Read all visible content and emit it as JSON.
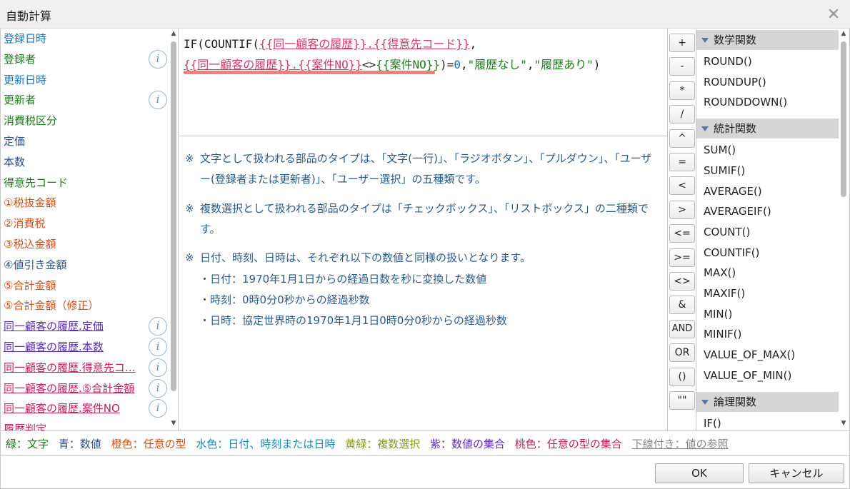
{
  "window": {
    "title": "自動計算"
  },
  "fields": [
    {
      "label": "登録日時",
      "color": "blue",
      "info": false
    },
    {
      "label": "登録者",
      "color": "green",
      "info": true
    },
    {
      "label": "更新日時",
      "color": "blue",
      "info": false
    },
    {
      "label": "更新者",
      "color": "green",
      "info": true
    },
    {
      "label": "消費税区分",
      "color": "green",
      "info": false
    },
    {
      "label": "定価",
      "color": "navy",
      "info": false
    },
    {
      "label": "本数",
      "color": "navy",
      "info": false
    },
    {
      "label": "得意先コード",
      "color": "green",
      "info": false
    },
    {
      "label": "①税抜金額",
      "color": "orange",
      "info": false
    },
    {
      "label": "②消費税",
      "color": "orange",
      "info": false
    },
    {
      "label": "③税込金額",
      "color": "orange",
      "info": false
    },
    {
      "label": "④値引き金額",
      "color": "navy",
      "info": false
    },
    {
      "label": "⑤合計金額",
      "color": "orange",
      "info": false
    },
    {
      "label": "⑤合計金額（修正）",
      "color": "orange",
      "info": false
    },
    {
      "label": "同一顧客の履歴.定価",
      "color": "purple",
      "info": true
    },
    {
      "label": "同一顧客の履歴.本数",
      "color": "purple",
      "info": true
    },
    {
      "label": "同一顧客の履歴.得意先コ…",
      "color": "pink",
      "info": true
    },
    {
      "label": "同一顧客の履歴.⑤合計金額",
      "color": "pink",
      "info": true
    },
    {
      "label": "同一顧客の履歴.案件NO",
      "color": "pink",
      "info": true
    },
    {
      "label": "履歴判定",
      "color": "pink",
      "info": false
    }
  ],
  "editor": {
    "line1": [
      {
        "t": "IF(COUNTIF(",
        "c": "dark"
      },
      {
        "t": "{{同一顧客の履歴}}.{{得意先コード}}",
        "c": "pink"
      },
      {
        "t": ",",
        "c": "dark"
      }
    ],
    "line2": [
      {
        "t": "{{同一顧客の履歴}}.{{案件NO}}",
        "c": "pink"
      },
      {
        "t": "<>",
        "c": "dark"
      },
      {
        "t": "{{案件NO}}",
        "c": "green"
      },
      {
        "t": ")=",
        "c": "dark"
      },
      {
        "t": "0",
        "c": "blue"
      },
      {
        "t": ",",
        "c": "dark"
      },
      {
        "t": "\"履歴なし\"",
        "c": "green"
      },
      {
        "t": ",",
        "c": "dark"
      },
      {
        "t": "\"履歴あり\"",
        "c": "green"
      },
      {
        "t": ")",
        "c": "dark"
      }
    ]
  },
  "notes": {
    "mark": "※",
    "n1": "文字として扱われる部品のタイプは、「文字(一行)」、「ラジオボタン」、「プルダウン」、「ユーザー(登録者または更新者)」、「ユーザー選択」の五種類です。",
    "n2": "複数選択として扱われる部品のタイプは「チェックボックス」、「リストボックス」の二種類です。",
    "n3": "日付、時刻、日時は、それぞれ以下の数値と同様の扱いとなります。",
    "s1": "・日付：1970年1月1日からの経過日数を秒に変換した数値",
    "s2": "・時刻：0時0分0秒からの経過秒数",
    "s3": "・日時：協定世界時の1970年1月1日0時0分0秒からの経過秒数"
  },
  "operators": [
    "+",
    "-",
    "*",
    "/",
    "^",
    "=",
    "<",
    ">",
    "<=",
    ">=",
    "<>",
    "&",
    "AND",
    "OR",
    "()",
    "\"\""
  ],
  "functions": {
    "math_title": "数学関数",
    "math": [
      "ROUND()",
      "ROUNDUP()",
      "ROUNDDOWN()"
    ],
    "stat_title": "統計関数",
    "stat": [
      "SUM()",
      "SUMIF()",
      "AVERAGE()",
      "AVERAGEIF()",
      "COUNT()",
      "COUNTIF()",
      "MAX()",
      "MAXIF()",
      "MIN()",
      "MINIF()",
      "VALUE_OF_MAX()",
      "VALUE_OF_MIN()"
    ],
    "logic_title": "論理関数",
    "logic": [
      "IF()"
    ]
  },
  "legend": {
    "green": "緑：文字",
    "blue": "青：数値",
    "orange": "橙色：任意の型",
    "cyan": "水色：日付、時刻または日時",
    "yellow": "黄緑：複数選択",
    "purple": "紫：数値の集合",
    "pink": "桃色：任意の型の集合",
    "underline": "下線付き：値の参照"
  },
  "buttons": {
    "ok": "OK",
    "cancel": "キャンセル"
  }
}
